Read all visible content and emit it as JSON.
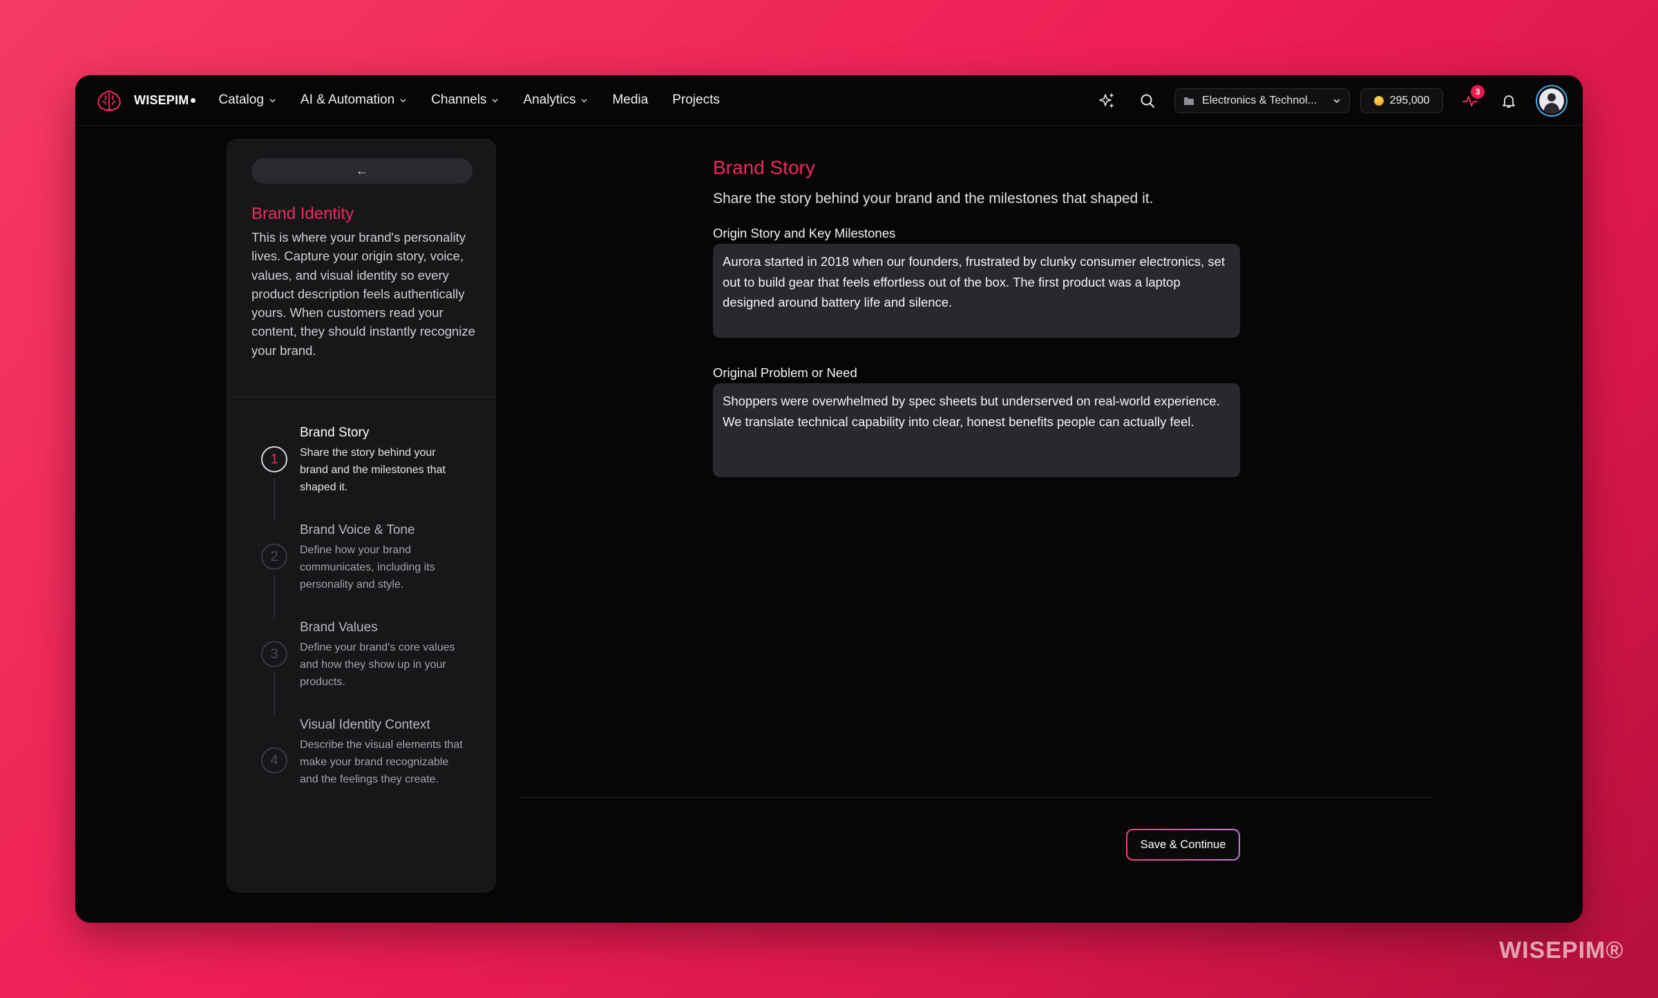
{
  "brand": {
    "name": "WISEPIM"
  },
  "nav": {
    "items": [
      {
        "label": "Catalog",
        "has_dropdown": true
      },
      {
        "label": "AI & Automation",
        "has_dropdown": true
      },
      {
        "label": "Channels",
        "has_dropdown": true
      },
      {
        "label": "Analytics",
        "has_dropdown": true
      },
      {
        "label": "Media",
        "has_dropdown": false
      },
      {
        "label": "Projects",
        "has_dropdown": false
      }
    ],
    "workspace": "Electronics & Technol...",
    "credits": "295,000",
    "activity_badge": "3"
  },
  "sidebar": {
    "back_icon": "←",
    "title": "Brand Identity",
    "description": "This is where your brand's personality lives. Capture your origin story, voice, values, and visual identity so every product description feels authentically yours. When customers read your content, they should instantly recognize your brand.",
    "steps": [
      {
        "number": "1",
        "title": "Brand Story",
        "description": "Share the story behind your brand and the milestones that shaped it.",
        "active": true
      },
      {
        "number": "2",
        "title": "Brand Voice & Tone",
        "description": "Define how your brand communicates, including its personality and style.",
        "active": false
      },
      {
        "number": "3",
        "title": "Brand Values",
        "description": "Define your brand's core values and how they show up in your products.",
        "active": false
      },
      {
        "number": "4",
        "title": "Visual Identity Context",
        "description": "Describe the visual elements that make your brand recognizable and the feelings they create.",
        "active": false
      }
    ]
  },
  "main": {
    "title": "Brand Story",
    "subtitle": "Share the story behind your brand and the milestones that shaped it.",
    "fields": [
      {
        "label": "Origin Story and Key Milestones",
        "value": "Aurora started in 2018 when our founders, frustrated by clunky consumer electronics, set out to build gear that feels effortless out of the box. The first product was a laptop designed around battery life and silence."
      },
      {
        "label": "Original Problem or Need",
        "value": "Shoppers were overwhelmed by spec sheets but underserved on real-world experience. We translate technical capability into clear, honest benefits people can actually feel."
      }
    ],
    "save_label": "Save & Continue"
  },
  "watermark": "WISEPIM®",
  "colors": {
    "accent": "#ee2b5b",
    "avatar_ring": "#48a8e8",
    "badge": "#e8194f"
  }
}
